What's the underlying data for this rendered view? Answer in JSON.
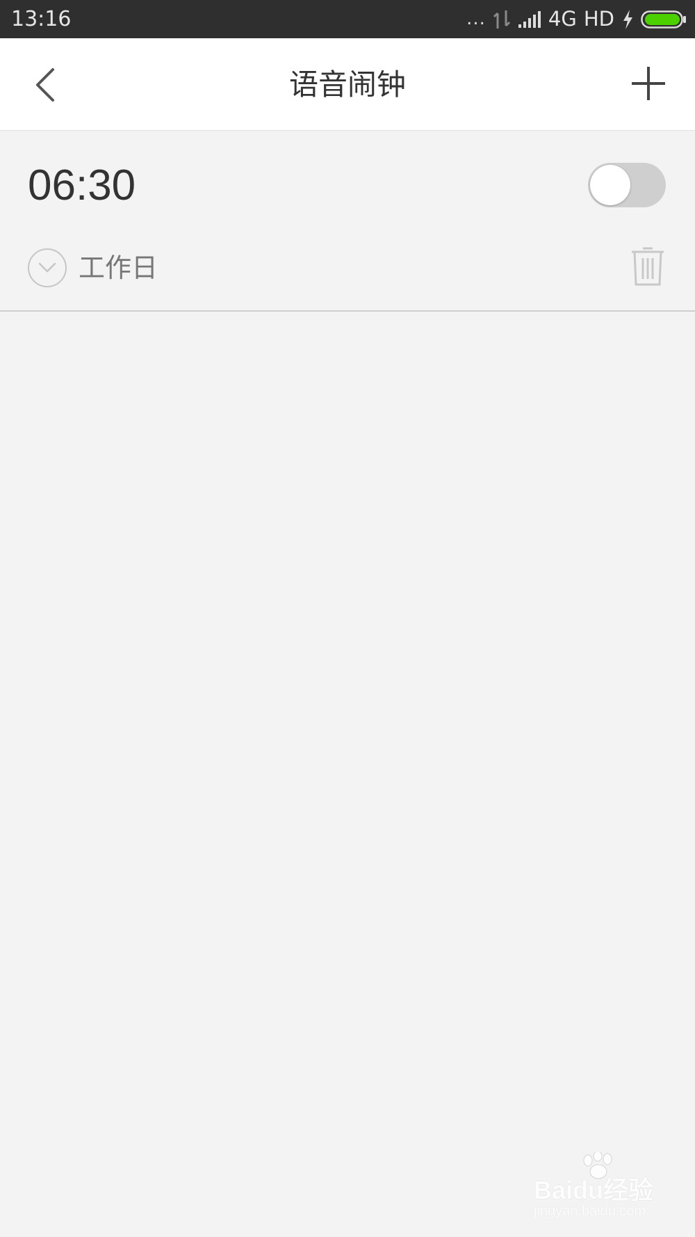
{
  "status_bar": {
    "time": "13:16",
    "dots": "...",
    "network": "4G",
    "hd": "HD",
    "battery_color": "#4cd000"
  },
  "header": {
    "title": "语音闹钟",
    "back_icon": "chevron-left-icon",
    "add_icon": "plus-icon"
  },
  "alarms": [
    {
      "time": "06:30",
      "enabled": false,
      "repeat": "工作日"
    }
  ],
  "watermark": {
    "main": "Baidu经验",
    "sub": "jingyan.baidu.com"
  }
}
